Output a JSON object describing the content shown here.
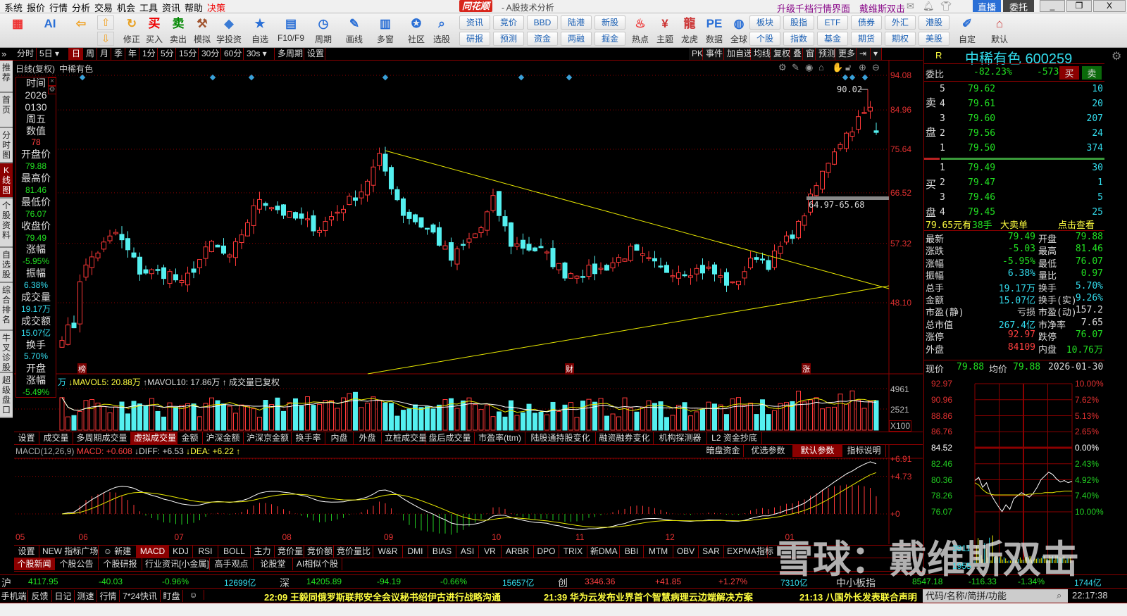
{
  "menu": {
    "items": [
      "系统",
      "报价",
      "行情",
      "分析",
      "交易",
      "机会",
      "工具",
      "资讯",
      "帮助",
      "决策"
    ],
    "logo": "同花顺",
    "title": "- A股技术分析",
    "upgrade": "升级千档行情界面",
    "user": "戴维斯双击",
    "live": "直播",
    "trade": "委托",
    "min": "_",
    "max": "❐",
    "close": "X"
  },
  "toolbar": {
    "big": [
      {
        "label": "",
        "icon": "▦",
        "color": "#e33"
      },
      {
        "label": "",
        "icon": "AI",
        "color": "#2a6fd6"
      },
      {
        "label": "",
        "icon": "⇦",
        "color": "#f0a020"
      },
      {
        "label": "修正",
        "icon": "↻",
        "color": "#e8a020"
      },
      {
        "label": "买入",
        "icon": "买",
        "color": "#e00"
      },
      {
        "label": "卖出",
        "icon": "卖",
        "color": "#080"
      },
      {
        "label": "模拟",
        "icon": "⚒",
        "color": "#a0522d"
      },
      {
        "label": "学投资",
        "icon": "◆",
        "color": "#3a7bd5"
      },
      {
        "label": "自选",
        "icon": "★",
        "color": "#2a6fd6"
      },
      {
        "label": "F10/F9",
        "icon": "▤",
        "color": "#2a6fd6"
      },
      {
        "label": "周期",
        "icon": "◷",
        "color": "#2a6fd6"
      },
      {
        "label": "画线",
        "icon": "✎",
        "color": "#2a6fd6"
      },
      {
        "label": "多窗",
        "icon": "▥",
        "color": "#2a6fd6"
      },
      {
        "label": "社区",
        "icon": "✪",
        "color": "#2a6fd6"
      },
      {
        "label": "选股",
        "icon": "⌕",
        "color": "#2a6fd6"
      }
    ],
    "updown": [
      "⇧",
      "⇩"
    ],
    "small": [
      [
        "资讯",
        "研报"
      ],
      [
        "竞价",
        "预测"
      ],
      [
        "BBD",
        "资金"
      ],
      [
        "陆港",
        "两融"
      ],
      [
        "新股",
        "掘金"
      ]
    ],
    "mid": [
      {
        "label": "热点",
        "icon": "♨",
        "color": "#e33"
      },
      {
        "label": "主题",
        "icon": "¥",
        "color": "#c33"
      },
      {
        "label": "龙虎",
        "icon": "龍",
        "color": "#c33"
      },
      {
        "label": "数据",
        "icon": "PE",
        "color": "#2a6fd6"
      },
      {
        "label": "全球",
        "icon": "◍",
        "color": "#2a6fd6"
      }
    ],
    "small2": [
      [
        "板块",
        "个股"
      ],
      [
        "股指",
        "指数"
      ],
      [
        "ETF",
        "基金"
      ],
      [
        "债券",
        "期货"
      ],
      [
        "外汇",
        "期权"
      ],
      [
        "港股",
        "美股"
      ]
    ],
    "end": [
      {
        "label": "自定",
        "icon": "✐",
        "color": "#2a6fd6"
      },
      {
        "label": "默认",
        "icon": "⌂",
        "color": "#c33"
      }
    ]
  },
  "period_tabs": [
    "分时",
    "5日 ▾",
    "日",
    "周",
    "月",
    "季",
    "年",
    "1分",
    "5分",
    "15分",
    "30分",
    "60分",
    "30s ▾",
    "多周期",
    "设置"
  ],
  "period_active": 2,
  "chart_tools": [
    "PK",
    "事件",
    "加自选",
    "均线",
    "复权",
    "叠",
    "窗",
    "预测",
    "更多",
    "⇥",
    "▾"
  ],
  "side_tabs": [
    "推荐",
    "首页",
    "分时图",
    "K线图",
    "个股资料",
    "自选股",
    "综合排名",
    "牛叉诊股",
    "超级盘口"
  ],
  "side_active": 3,
  "chart_header": {
    "mode": "日线(复权)",
    "name": "中稀有色"
  },
  "icons": [
    "gear-icon",
    "pen-icon",
    "eye-icon",
    "toolbox-icon",
    "hand-icon",
    "lock-icon",
    "zoom-in-icon",
    "zoom-out-icon"
  ],
  "info_popup": [
    [
      "时间",
      "w"
    ],
    [
      "2026",
      "w"
    ],
    [
      "0130",
      "w"
    ],
    [
      "周五",
      "w"
    ],
    [
      "数值",
      "w"
    ],
    [
      "78",
      "r"
    ],
    [
      "开盘价",
      "w"
    ],
    [
      "79.88",
      "g"
    ],
    [
      "最高价",
      "w"
    ],
    [
      "81.46",
      "g"
    ],
    [
      "最低价",
      "w"
    ],
    [
      "76.07",
      "g"
    ],
    [
      "收盘价",
      "w"
    ],
    [
      "79.49",
      "g"
    ],
    [
      "涨幅",
      "w"
    ],
    [
      "-5.95%",
      "g"
    ],
    [
      "振幅",
      "w"
    ],
    [
      "6.38%",
      "c"
    ],
    [
      "成交量",
      "w"
    ],
    [
      "19.17万",
      "c"
    ],
    [
      "成交额",
      "w"
    ],
    [
      "15.07亿",
      "c"
    ],
    [
      "换手",
      "w"
    ],
    [
      "5.70%",
      "c"
    ],
    [
      "开盘",
      "w"
    ],
    [
      "涨幅",
      "w"
    ],
    [
      "-5.49%",
      "g"
    ]
  ],
  "chart_data": {
    "type": "candlestick",
    "price_axis": [
      "94.08",
      "84.96",
      "75.64",
      "66.52",
      "57.32",
      "48.10"
    ],
    "price_axis_values": [
      94.08,
      84.96,
      75.64,
      66.52,
      57.32,
      48.1
    ],
    "x_ticks": [
      "05",
      "06",
      "07",
      "08",
      "09",
      "10",
      "11",
      "12",
      "01"
    ],
    "x_tick_index": [
      -8,
      3,
      19,
      37,
      54,
      72,
      86,
      101,
      121
    ],
    "key_closes": [
      [
        0,
        43.8
      ],
      [
        2,
        45
      ],
      [
        3,
        51.7
      ],
      [
        5,
        55
      ],
      [
        9,
        59.1
      ],
      [
        13,
        52.8
      ],
      [
        18,
        52.4
      ],
      [
        20,
        50.6
      ],
      [
        25,
        57.3
      ],
      [
        28,
        54.6
      ],
      [
        33,
        65.6
      ],
      [
        38,
        62
      ],
      [
        43,
        60
      ],
      [
        50,
        67
      ],
      [
        53,
        73.6
      ],
      [
        57,
        62.7
      ],
      [
        62,
        59
      ],
      [
        65,
        54.6
      ],
      [
        70,
        60
      ],
      [
        72,
        65
      ],
      [
        75,
        57.3
      ],
      [
        80,
        56
      ],
      [
        84,
        52.5
      ],
      [
        90,
        53
      ],
      [
        95,
        56
      ],
      [
        100,
        53
      ],
      [
        108,
        53
      ],
      [
        112,
        50.5
      ],
      [
        116,
        55.4
      ],
      [
        118,
        54
      ],
      [
        123,
        60.3
      ],
      [
        126,
        67.8
      ],
      [
        129,
        75.8
      ],
      [
        133,
        82.5
      ],
      [
        135,
        85
      ],
      [
        136,
        79.49
      ]
    ],
    "last": {
      "open": 79.88,
      "high": 81.46,
      "low": 76.07,
      "close": 79.49
    },
    "annotations": {
      "high_label": "90.02",
      "gap_label": "64.97-65.68",
      "markers": [
        "榜",
        "财",
        "涨"
      ]
    },
    "volume": {
      "header_prefix": "万",
      "mavol5": "↓MAVOL5: 20.88万",
      "mavol10": "↑MAVOL10: 17.86万",
      "tail": "↑ 成交量已复权",
      "axis": [
        "4961",
        "2521",
        "X100"
      ],
      "axis_values": [
        4961,
        2521
      ]
    },
    "macd": {
      "label": "MACD(12,26,9)",
      "macd": "MACD: +0.608",
      "diff": "↓DIFF: +6.53",
      "dea": "↓DEA: +6.22 ↑",
      "axis": [
        "+6.91",
        "+4.73",
        "+0"
      ],
      "axis_values": [
        6.91,
        4.73,
        0
      ]
    }
  },
  "volume_tabs": [
    "设置",
    "成交量",
    "多周期成交量",
    "虚拟成交量",
    "金额",
    "沪深金额",
    "沪深京金额",
    "换手率",
    "内盘",
    "外盘",
    "立桩成交量",
    "盘后成交量",
    "市盈率(ttm)",
    "陆股通持股变化",
    "融资融券变化",
    "机构探测器",
    "L2 资金抄底"
  ],
  "volume_active": 3,
  "macd_buttons": [
    "暗盘资金",
    "优选参数",
    "默认参数",
    "指标说明"
  ],
  "indicator_tabs": [
    "设置",
    "NEW 指标广场",
    "☺ 新建",
    "MACD",
    "KDJ",
    "RSI",
    "BOLL",
    "主力",
    "竞价量",
    "竞价额",
    "竞价量比",
    "W&R",
    "DMI",
    "BIAS",
    "ASI",
    "VR",
    "ARBR",
    "DPO",
    "TRIX",
    "新DMA",
    "BBI",
    "MTM",
    "OBV",
    "SAR",
    "EXPMA指标"
  ],
  "indicator_active": 3,
  "news_tabs": [
    "个股新闻",
    "个股公告",
    "个股研报",
    "行业资讯[小金属]",
    "高手观点",
    "论股堂",
    "AI相似个股"
  ],
  "quote": {
    "flag": "R",
    "title": "中稀有色 600259",
    "weibi_label": "委比",
    "weibi": "-82.23%",
    "weicha": "-573",
    "buy": "买",
    "sell": "卖",
    "sell_label": [
      "卖",
      "盘"
    ],
    "buy_label": [
      "买",
      "盘"
    ],
    "asks": [
      [
        "5",
        "79.62",
        "10"
      ],
      [
        "4",
        "79.61",
        "20"
      ],
      [
        "3",
        "79.60",
        "207"
      ],
      [
        "2",
        "79.56",
        "24"
      ],
      [
        "1",
        "79.50",
        "374"
      ]
    ],
    "bids": [
      [
        "1",
        "79.49",
        "30"
      ],
      [
        "2",
        "79.47",
        "1"
      ],
      [
        "3",
        "79.46",
        "5"
      ],
      [
        "4",
        "79.45",
        "25"
      ]
    ],
    "big_order": {
      "price": "79.65元有",
      "qty": "38手",
      "type": "大卖单",
      "link": "点击查看"
    },
    "stats": [
      [
        "最新",
        "79.49",
        "g",
        "开盘",
        "79.88",
        "g"
      ],
      [
        "涨跌",
        "-5.03",
        "g",
        "最高",
        "81.46",
        "g"
      ],
      [
        "涨幅",
        "-5.95%",
        "g",
        "最低",
        "76.07",
        "g"
      ],
      [
        "振幅",
        "6.38%",
        "c",
        "量比",
        "0.97",
        "g"
      ],
      [
        "总手",
        "19.17万",
        "c",
        "换手",
        "5.70%",
        "c"
      ],
      [
        "金额",
        "15.07亿",
        "c",
        "换手(实)",
        "9.26%",
        "c"
      ],
      [
        "市盈(静)",
        "亏损",
        "w",
        "市盈(动)",
        "157.2",
        "w"
      ],
      [
        "总市值",
        "267.4亿",
        "c",
        "市净率",
        "7.65",
        "w"
      ],
      [
        "涨停",
        "92.97",
        "r",
        "跌停",
        "76.07",
        "g"
      ],
      [
        "外盘",
        "84109",
        "r",
        "内盘",
        "10.76万",
        "g"
      ]
    ],
    "now_label": "现价",
    "now": "79.88",
    "avg_label": "均价",
    "avg": "79.88",
    "date": "2026-01-30"
  },
  "intraday": {
    "left": [
      "92.97",
      "90.96",
      "88.86",
      "86.76",
      "84.52",
      "82.46",
      "80.36",
      "78.26",
      "76.07"
    ],
    "right": [
      "10.00%",
      "7.62%",
      "5.13%",
      "2.65%",
      "0.00%",
      "2.43%",
      "4.92%",
      "7.40%",
      "10.00%"
    ],
    "vol_axis": [
      "3911",
      "1955"
    ],
    "price_path": [
      80.2,
      80.6,
      79.3,
      79.9,
      78.5,
      77.6,
      76.8,
      76.1,
      77.0,
      76.4,
      77.8,
      78.2,
      78.6,
      78.3,
      78.0,
      78.5,
      79.3,
      80.3,
      80.8,
      81.3,
      81.0,
      80.4,
      80.0,
      80.2,
      79.9,
      80.1
    ],
    "avg_path": [
      79.9,
      79.6,
      79.0,
      78.6,
      78.4,
      78.3,
      78.3,
      78.3,
      78.3,
      78.3,
      78.3,
      78.3,
      78.3,
      78.3,
      78.4,
      78.4,
      78.5,
      78.5,
      78.6,
      78.6,
      78.6,
      78.7,
      78.7,
      78.8,
      78.8,
      78.8
    ]
  },
  "index_bar": [
    {
      "name": "沪",
      "price": "4117.95",
      "chg": "-40.03",
      "pct": "-0.96%",
      "amt": "12699亿",
      "color": "g"
    },
    {
      "name": "深",
      "price": "14205.89",
      "chg": "-94.19",
      "pct": "-0.66%",
      "amt": "15657亿",
      "color": "g"
    },
    {
      "name": "创",
      "price": "3346.36",
      "chg": "+41.85",
      "pct": "+1.27%",
      "amt": "7310亿",
      "color": "r"
    },
    {
      "name": "中小板指",
      "price": "8547.18",
      "chg": "-116.33",
      "pct": "-1.34%",
      "amt": "1744亿",
      "color": "g"
    }
  ],
  "status": {
    "items": [
      "手机端",
      "反馈",
      "日记",
      "测速",
      "行情",
      "7*24快讯",
      "盯盘",
      "☺"
    ],
    "news": [
      "22:09 王毅同俄罗斯联邦安全会议秘书绍伊古进行战略沟通",
      "21:39 华为云发布业界首个智慧病理云边端解决方案",
      "21:13 八国外长发表联合声明"
    ],
    "search_placeholder": "代码/名称/简拼/功能",
    "clock": "22:17:38"
  },
  "watermark": "雪球：戴维斯双击",
  "colors": {
    "up": "#ff3838",
    "down": "#54f0f0",
    "trend": "#e8e800",
    "grid": "#8b0000"
  }
}
